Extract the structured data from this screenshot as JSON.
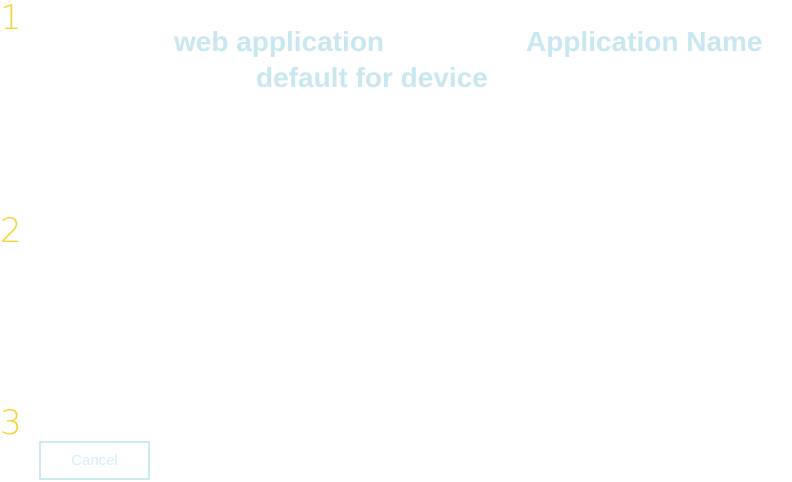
{
  "steps": {
    "one": "1",
    "two": "2",
    "three": "3"
  },
  "labels": {
    "web_application": "web application",
    "application_name": "Application Name",
    "default_for_device": "default for device"
  },
  "buttons": {
    "cancel": "Cancel"
  },
  "colors": {
    "step_number": "#f6d335",
    "label_text": "#c9e7f1",
    "button_border": "#cdeaf3",
    "button_text": "#d6eef6",
    "background": "#ffffff"
  }
}
